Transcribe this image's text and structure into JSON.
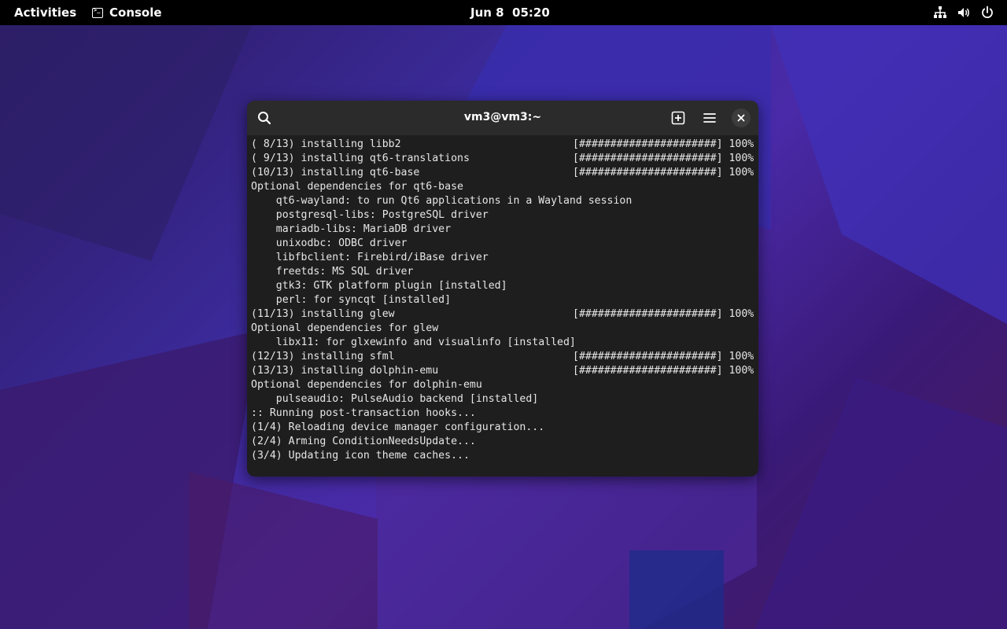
{
  "topbar": {
    "activities": "Activities",
    "app_name": "Console",
    "clock": "Jun 8  05:20"
  },
  "window": {
    "title": "vm3@vm3:~"
  },
  "terminal": {
    "progress_bar": "[######################] 100%",
    "lines": [
      {
        "text": "( 8/13) installing libb2",
        "progress": true
      },
      {
        "text": "( 9/13) installing qt6-translations",
        "progress": true
      },
      {
        "text": "(10/13) installing qt6-base",
        "progress": true
      },
      {
        "text": "Optional dependencies for qt6-base",
        "progress": false
      },
      {
        "text": "    qt6-wayland: to run Qt6 applications in a Wayland session",
        "progress": false
      },
      {
        "text": "    postgresql-libs: PostgreSQL driver",
        "progress": false
      },
      {
        "text": "    mariadb-libs: MariaDB driver",
        "progress": false
      },
      {
        "text": "    unixodbc: ODBC driver",
        "progress": false
      },
      {
        "text": "    libfbclient: Firebird/iBase driver",
        "progress": false
      },
      {
        "text": "    freetds: MS SQL driver",
        "progress": false
      },
      {
        "text": "    gtk3: GTK platform plugin [installed]",
        "progress": false
      },
      {
        "text": "    perl: for syncqt [installed]",
        "progress": false
      },
      {
        "text": "(11/13) installing glew",
        "progress": true
      },
      {
        "text": "Optional dependencies for glew",
        "progress": false
      },
      {
        "text": "    libx11: for glxewinfo and visualinfo [installed]",
        "progress": false
      },
      {
        "text": "(12/13) installing sfml",
        "progress": true
      },
      {
        "text": "(13/13) installing dolphin-emu",
        "progress": true
      },
      {
        "text": "Optional dependencies for dolphin-emu",
        "progress": false
      },
      {
        "text": "    pulseaudio: PulseAudio backend [installed]",
        "progress": false
      },
      {
        "text": ":: Running post-transaction hooks...",
        "progress": false
      },
      {
        "text": "(1/4) Reloading device manager configuration...",
        "progress": false
      },
      {
        "text": "(2/4) Arming ConditionNeedsUpdate...",
        "progress": false
      },
      {
        "text": "(3/4) Updating icon theme caches...",
        "progress": false
      }
    ]
  },
  "icons": {
    "search": "search-icon",
    "new_tab": "new-tab-icon",
    "menu": "hamburger-menu-icon",
    "close": "close-icon",
    "network": "network-icon",
    "volume": "volume-icon",
    "power": "power-icon"
  },
  "colors": {
    "topbar_bg": "#000000",
    "window_bg": "#1e1e1e",
    "titlebar_bg": "#2b2b2b",
    "terminal_text": "#e6e6e6",
    "wallpaper_accent": "#4a2aa8"
  }
}
